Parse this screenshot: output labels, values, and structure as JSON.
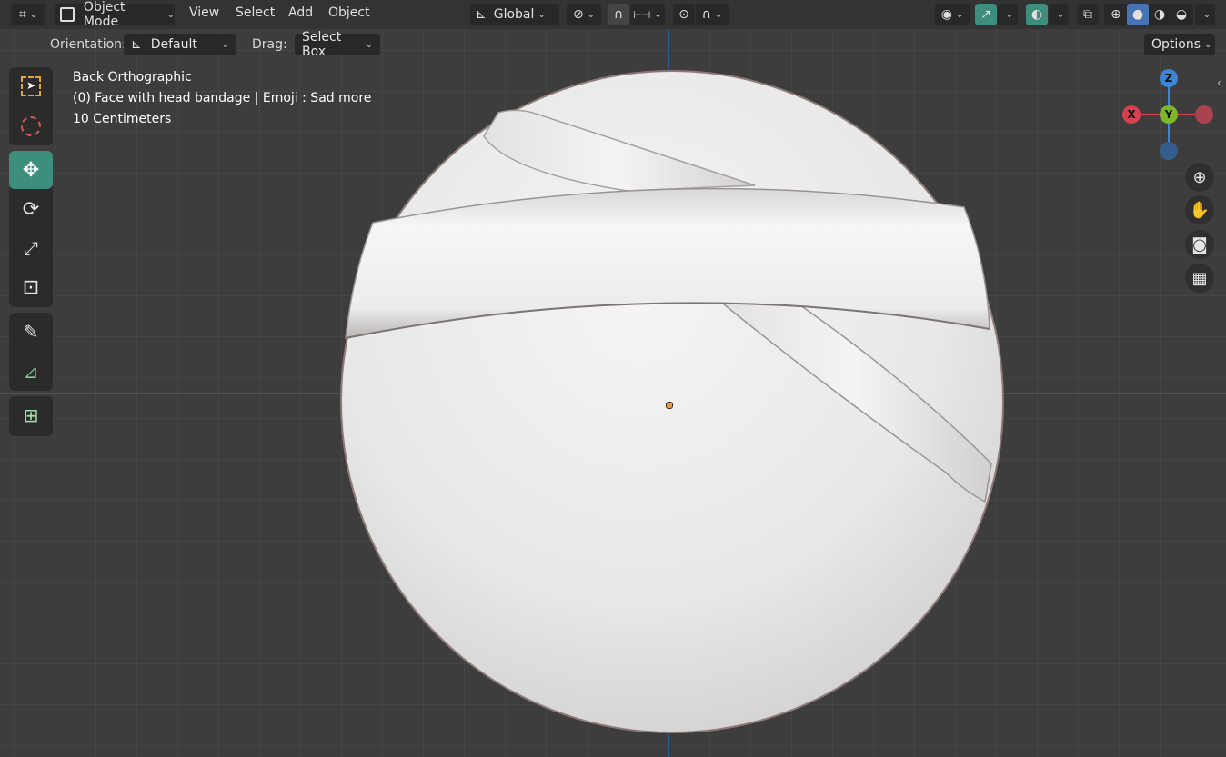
{
  "header": {
    "mode_label": "Object Mode",
    "menus": [
      "View",
      "Select",
      "Add",
      "Object"
    ],
    "transform_orientation": "Global"
  },
  "subheader": {
    "orientation_label": "Orientation:",
    "orientation_value": "Default",
    "drag_label": "Drag:",
    "drag_value": "Select Box",
    "options_label": "Options"
  },
  "overlay_info": {
    "view_name": "Back Orthographic",
    "object_name": "(0) Face with head bandage | Emoji : Sad more",
    "scale": "10 Centimeters"
  },
  "gizmo": {
    "z": "Z",
    "y": "Y",
    "x": "X"
  },
  "colors": {
    "accent": "#3d8e7c",
    "x_axis": "#d8404f",
    "y_axis": "#7bb728",
    "z_axis": "#3d85d6",
    "origin": "#f29a3c"
  },
  "tools": [
    "select-box-icon",
    "cursor-icon",
    "move-icon",
    "rotate-icon",
    "scale-icon",
    "transform-icon",
    "annotate-icon",
    "measure-icon",
    "add-cube-icon"
  ],
  "nav_buttons": [
    "zoom-icon",
    "hand-pan-icon",
    "camera-icon",
    "grid-icon"
  ]
}
